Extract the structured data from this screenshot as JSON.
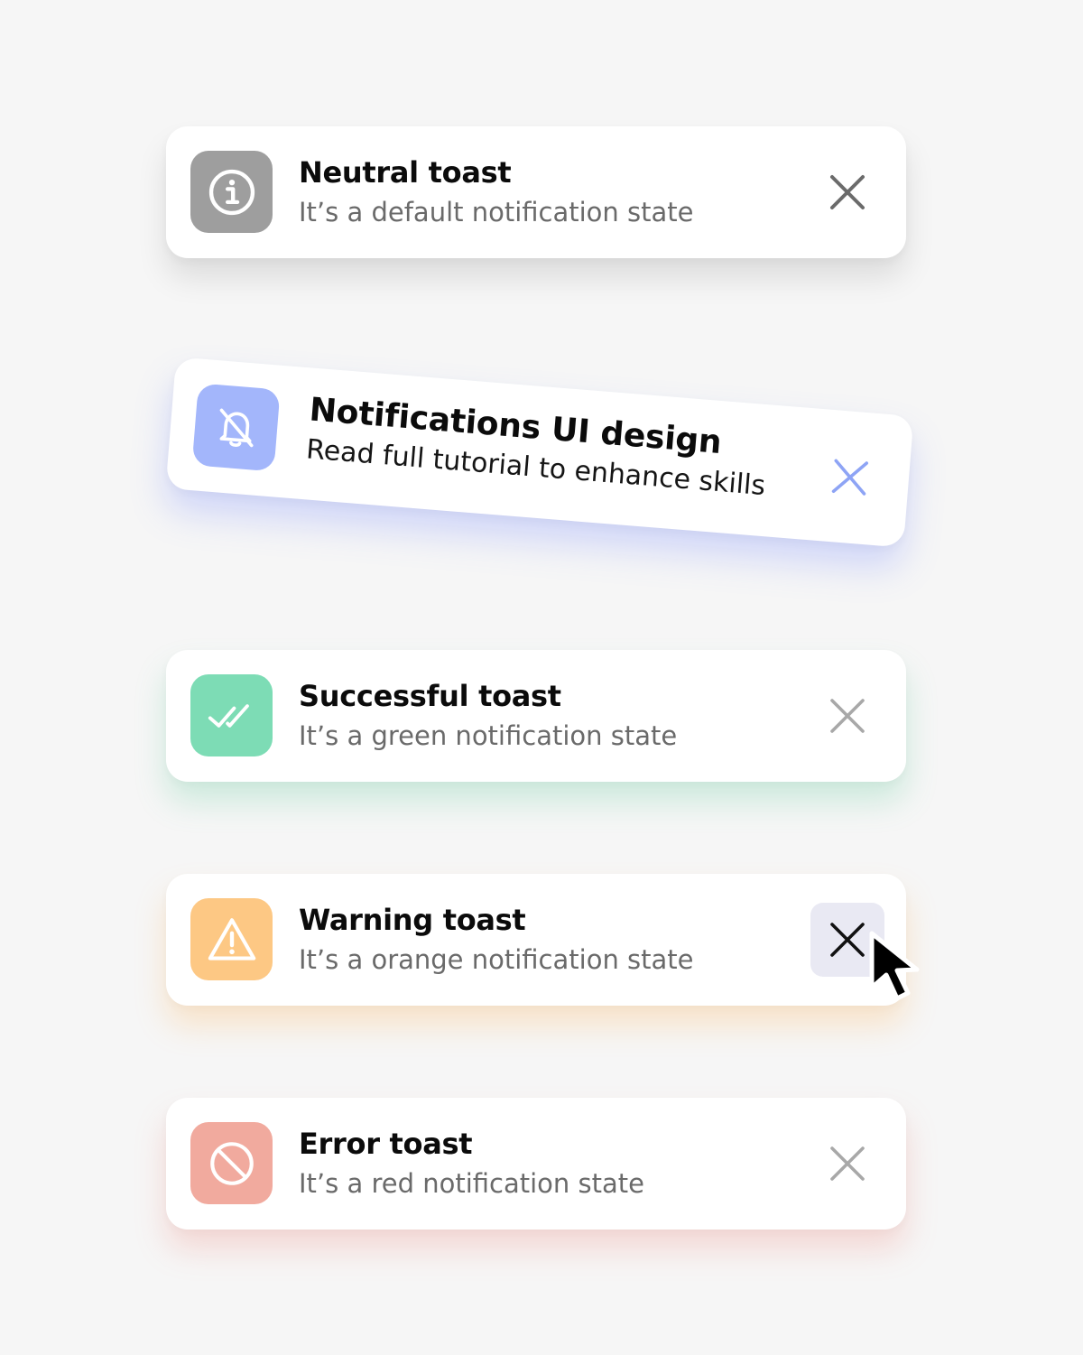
{
  "toasts": [
    {
      "type": "neutral",
      "title": "Neutral toast",
      "subtitle": "It’s a default notification state",
      "icon": "info-icon",
      "icon_color": "#9e9e9e",
      "close_color": "#6b6b6b"
    },
    {
      "type": "promo",
      "title": "Notifications UI design",
      "subtitle": "Read full tutorial to enhance skills",
      "icon": "bell-off-icon",
      "icon_color": "#a3b6fb",
      "close_color": "#8ea4f5"
    },
    {
      "type": "success",
      "title": "Successful toast",
      "subtitle": "It’s a green notification state",
      "icon": "double-check-icon",
      "icon_color": "#7ddcb5",
      "close_color": "#a8a8a8"
    },
    {
      "type": "warning",
      "title": "Warning toast",
      "subtitle": "It’s a orange notification state",
      "icon": "warning-triangle-icon",
      "icon_color": "#fdc884",
      "close_color": "#111111",
      "close_hovered": true
    },
    {
      "type": "error",
      "title": "Error toast",
      "subtitle": "It’s a red notification state",
      "icon": "block-icon",
      "icon_color": "#f1aa9e",
      "close_color": "#a8a8a8"
    }
  ],
  "background_color": "#f6f6f6",
  "cursor": "arrow-pointer-icon"
}
